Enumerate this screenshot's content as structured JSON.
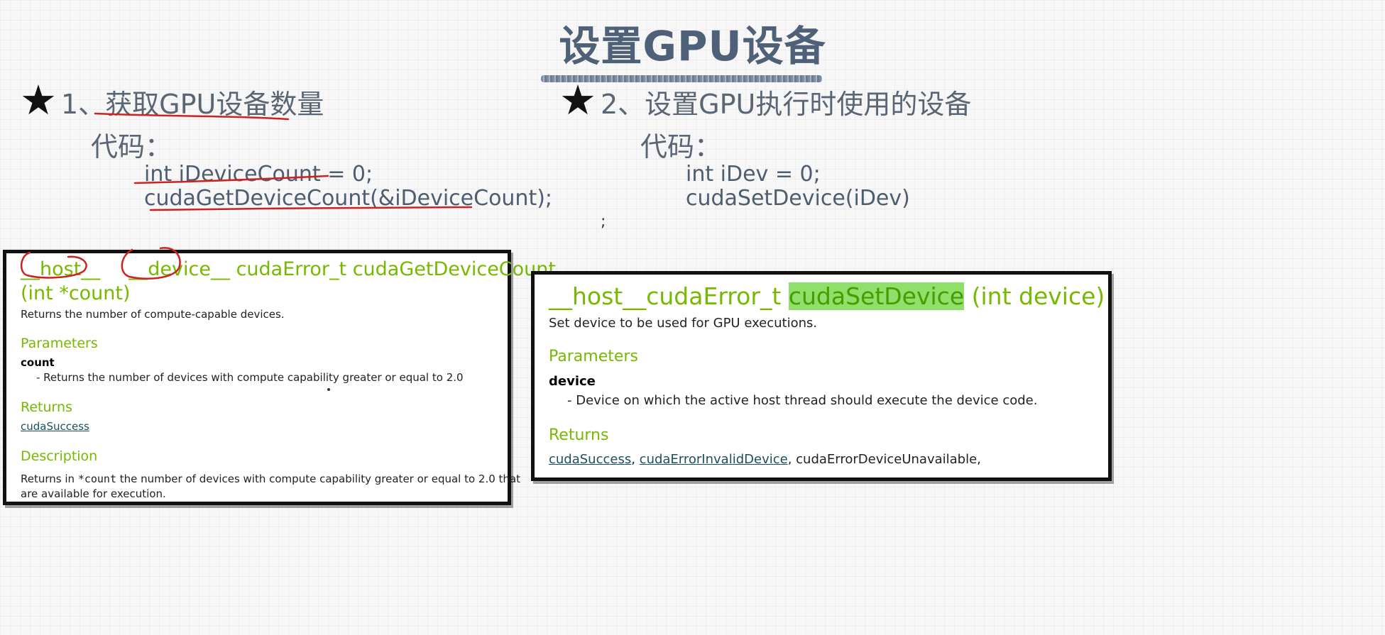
{
  "page": {
    "title": "设置GPU设备"
  },
  "left": {
    "star": "★",
    "heading": "1、获取GPU设备数量",
    "code_label": "代码：",
    "code_lines": [
      "int iDeviceCount = 0;",
      "cudaGetDeviceCount(&iDeviceCount);"
    ],
    "doc": {
      "sig_host": "__host__",
      "sig_device": "__device__",
      "sig_rest": "cudaError_t cudaGetDeviceCount",
      "sig_params": "(int *count)",
      "summary": "Returns the number of compute-capable devices.",
      "parameters_label": "Parameters",
      "param_name": "count",
      "param_desc": "- Returns the number of devices with compute capability greater or equal to 2.0",
      "returns_label": "Returns",
      "returns_link": "cudaSuccess",
      "description_label": "Description",
      "desc_before": "Returns in ",
      "desc_code": "*count",
      "desc_after": " the number of devices with compute capability greater or equal to 2.0 that",
      "desc_line2": "are available for execution."
    }
  },
  "right": {
    "star": "★",
    "heading": "2、设置GPU执行时使用的设备",
    "code_label": "代码：",
    "code_lines": [
      "int iDev = 0;",
      "cudaSetDevice(iDev)"
    ],
    "stray": ";",
    "doc": {
      "sig_before": "__host__cudaError_t ",
      "sig_highlight": "cudaSetDevice",
      "sig_after": " (int device)",
      "summary": "Set device to be used for GPU executions.",
      "parameters_label": "Parameters",
      "param_name": "device",
      "param_desc": "- Device on which the active host thread should execute the device code.",
      "returns_label": "Returns",
      "return_link1": "cudaSuccess",
      "sep1": ", ",
      "return_link2": "cudaErrorInvalidDevice",
      "sep2": ", ",
      "return_plain": "cudaErrorDeviceUnavailable,"
    }
  },
  "colors": {
    "accent": "#76b900",
    "title": "#4f6178",
    "annotation": "#cc2222"
  }
}
